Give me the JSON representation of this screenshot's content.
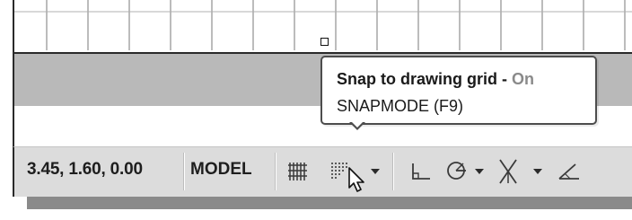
{
  "status_bar": {
    "coordinates": "3.45, 1.60, 0.00",
    "model_label": "MODEL",
    "tools": [
      {
        "name": "grid-display-icon",
        "dropdown": false
      },
      {
        "name": "snap-mode-icon",
        "dropdown": true
      },
      {
        "name": "ortho-mode-icon",
        "dropdown": false
      },
      {
        "name": "polar-tracking-icon",
        "dropdown": true
      },
      {
        "name": "isometric-drafting-icon",
        "dropdown": true
      },
      {
        "name": "object-snap-tracking-icon",
        "dropdown": false
      }
    ]
  },
  "tooltip": {
    "title": "Snap to drawing grid - ",
    "state": "On",
    "subtitle": "SNAPMODE (F9)"
  },
  "colors": {
    "band": "#b9b9b9",
    "status_bar": "#dcdcdc",
    "tooltip_state": "#8a8a8a"
  }
}
